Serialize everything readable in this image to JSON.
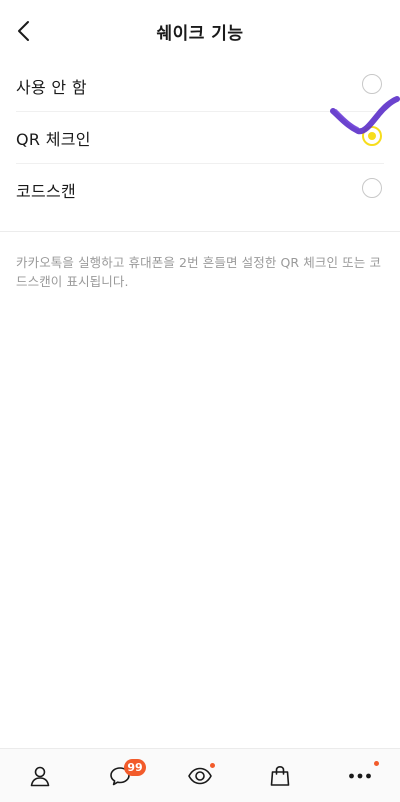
{
  "header": {
    "title": "쉐이크 기능",
    "back_icon": "chevron-left-icon"
  },
  "options": [
    {
      "label": "사용 안 함",
      "selected": false
    },
    {
      "label": "QR 체크인",
      "selected": true
    },
    {
      "label": "코드스캔",
      "selected": false
    }
  ],
  "description": "카카오톡을 실행하고 휴대폰을 2번 흔들면 설정한 QR 체크인 또는 코드스캔이 표시됩니다.",
  "tab_bar": {
    "tabs": [
      {
        "name": "friends",
        "icon": "person-icon"
      },
      {
        "name": "chats",
        "icon": "chat-bubble-icon",
        "badge": "99"
      },
      {
        "name": "view",
        "icon": "eye-icon",
        "has_dot": true
      },
      {
        "name": "shopping",
        "icon": "shopping-bag-icon"
      },
      {
        "name": "more",
        "icon": "more-dots-icon",
        "has_dot": true
      }
    ]
  },
  "colors": {
    "radio_selected": "#f7dd1c",
    "badge": "#f25b2b",
    "check_mark": "#5b2fc9"
  }
}
